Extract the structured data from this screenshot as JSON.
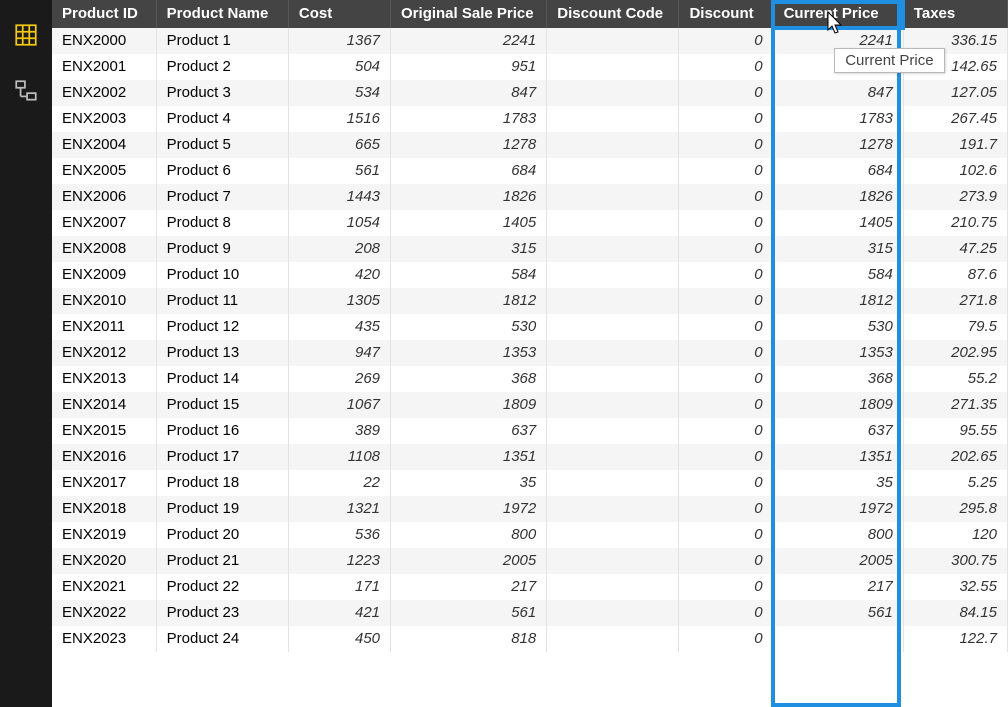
{
  "sidebar": {
    "icons": [
      "table-icon",
      "model-icon"
    ]
  },
  "columns": [
    {
      "key": "pid",
      "label": "Product ID",
      "cls": "c-pid",
      "num": false
    },
    {
      "key": "pname",
      "label": "Product Name",
      "cls": "c-pname",
      "num": false
    },
    {
      "key": "cost",
      "label": "Cost",
      "cls": "c-cost",
      "num": true
    },
    {
      "key": "osp",
      "label": "Original Sale Price",
      "cls": "c-osp",
      "num": true
    },
    {
      "key": "dc",
      "label": "Discount Code",
      "cls": "c-dc",
      "num": false
    },
    {
      "key": "disc",
      "label": "Discount",
      "cls": "c-disc",
      "num": true
    },
    {
      "key": "cp",
      "label": "Current Price",
      "cls": "c-cp",
      "num": true,
      "selected": true
    },
    {
      "key": "tax",
      "label": "Taxes",
      "cls": "c-tax",
      "num": true
    }
  ],
  "tooltip": {
    "text": "Current Price"
  },
  "rows": [
    {
      "pid": "ENX2000",
      "pname": "Product 1",
      "cost": "1367",
      "osp": "2241",
      "dc": "",
      "disc": "0",
      "cp": "2241",
      "tax": "336.15"
    },
    {
      "pid": "ENX2001",
      "pname": "Product 2",
      "cost": "504",
      "osp": "951",
      "dc": "",
      "disc": "0",
      "cp": "",
      "tax": "142.65"
    },
    {
      "pid": "ENX2002",
      "pname": "Product 3",
      "cost": "534",
      "osp": "847",
      "dc": "",
      "disc": "0",
      "cp": "847",
      "tax": "127.05"
    },
    {
      "pid": "ENX2003",
      "pname": "Product 4",
      "cost": "1516",
      "osp": "1783",
      "dc": "",
      "disc": "0",
      "cp": "1783",
      "tax": "267.45"
    },
    {
      "pid": "ENX2004",
      "pname": "Product 5",
      "cost": "665",
      "osp": "1278",
      "dc": "",
      "disc": "0",
      "cp": "1278",
      "tax": "191.7"
    },
    {
      "pid": "ENX2005",
      "pname": "Product 6",
      "cost": "561",
      "osp": "684",
      "dc": "",
      "disc": "0",
      "cp": "684",
      "tax": "102.6"
    },
    {
      "pid": "ENX2006",
      "pname": "Product 7",
      "cost": "1443",
      "osp": "1826",
      "dc": "",
      "disc": "0",
      "cp": "1826",
      "tax": "273.9"
    },
    {
      "pid": "ENX2007",
      "pname": "Product 8",
      "cost": "1054",
      "osp": "1405",
      "dc": "",
      "disc": "0",
      "cp": "1405",
      "tax": "210.75"
    },
    {
      "pid": "ENX2008",
      "pname": "Product 9",
      "cost": "208",
      "osp": "315",
      "dc": "",
      "disc": "0",
      "cp": "315",
      "tax": "47.25"
    },
    {
      "pid": "ENX2009",
      "pname": "Product 10",
      "cost": "420",
      "osp": "584",
      "dc": "",
      "disc": "0",
      "cp": "584",
      "tax": "87.6"
    },
    {
      "pid": "ENX2010",
      "pname": "Product 11",
      "cost": "1305",
      "osp": "1812",
      "dc": "",
      "disc": "0",
      "cp": "1812",
      "tax": "271.8"
    },
    {
      "pid": "ENX2011",
      "pname": "Product 12",
      "cost": "435",
      "osp": "530",
      "dc": "",
      "disc": "0",
      "cp": "530",
      "tax": "79.5"
    },
    {
      "pid": "ENX2012",
      "pname": "Product 13",
      "cost": "947",
      "osp": "1353",
      "dc": "",
      "disc": "0",
      "cp": "1353",
      "tax": "202.95"
    },
    {
      "pid": "ENX2013",
      "pname": "Product 14",
      "cost": "269",
      "osp": "368",
      "dc": "",
      "disc": "0",
      "cp": "368",
      "tax": "55.2"
    },
    {
      "pid": "ENX2014",
      "pname": "Product 15",
      "cost": "1067",
      "osp": "1809",
      "dc": "",
      "disc": "0",
      "cp": "1809",
      "tax": "271.35"
    },
    {
      "pid": "ENX2015",
      "pname": "Product 16",
      "cost": "389",
      "osp": "637",
      "dc": "",
      "disc": "0",
      "cp": "637",
      "tax": "95.55"
    },
    {
      "pid": "ENX2016",
      "pname": "Product 17",
      "cost": "1108",
      "osp": "1351",
      "dc": "",
      "disc": "0",
      "cp": "1351",
      "tax": "202.65"
    },
    {
      "pid": "ENX2017",
      "pname": "Product 18",
      "cost": "22",
      "osp": "35",
      "dc": "",
      "disc": "0",
      "cp": "35",
      "tax": "5.25"
    },
    {
      "pid": "ENX2018",
      "pname": "Product 19",
      "cost": "1321",
      "osp": "1972",
      "dc": "",
      "disc": "0",
      "cp": "1972",
      "tax": "295.8"
    },
    {
      "pid": "ENX2019",
      "pname": "Product 20",
      "cost": "536",
      "osp": "800",
      "dc": "",
      "disc": "0",
      "cp": "800",
      "tax": "120"
    },
    {
      "pid": "ENX2020",
      "pname": "Product 21",
      "cost": "1223",
      "osp": "2005",
      "dc": "",
      "disc": "0",
      "cp": "2005",
      "tax": "300.75"
    },
    {
      "pid": "ENX2021",
      "pname": "Product 22",
      "cost": "171",
      "osp": "217",
      "dc": "",
      "disc": "0",
      "cp": "217",
      "tax": "32.55"
    },
    {
      "pid": "ENX2022",
      "pname": "Product 23",
      "cost": "421",
      "osp": "561",
      "dc": "",
      "disc": "0",
      "cp": "561",
      "tax": "84.15"
    },
    {
      "pid": "ENX2023",
      "pname": "Product 24",
      "cost": "450",
      "osp": "818",
      "dc": "",
      "disc": "0",
      "cp": "",
      "tax": "122.7"
    }
  ]
}
